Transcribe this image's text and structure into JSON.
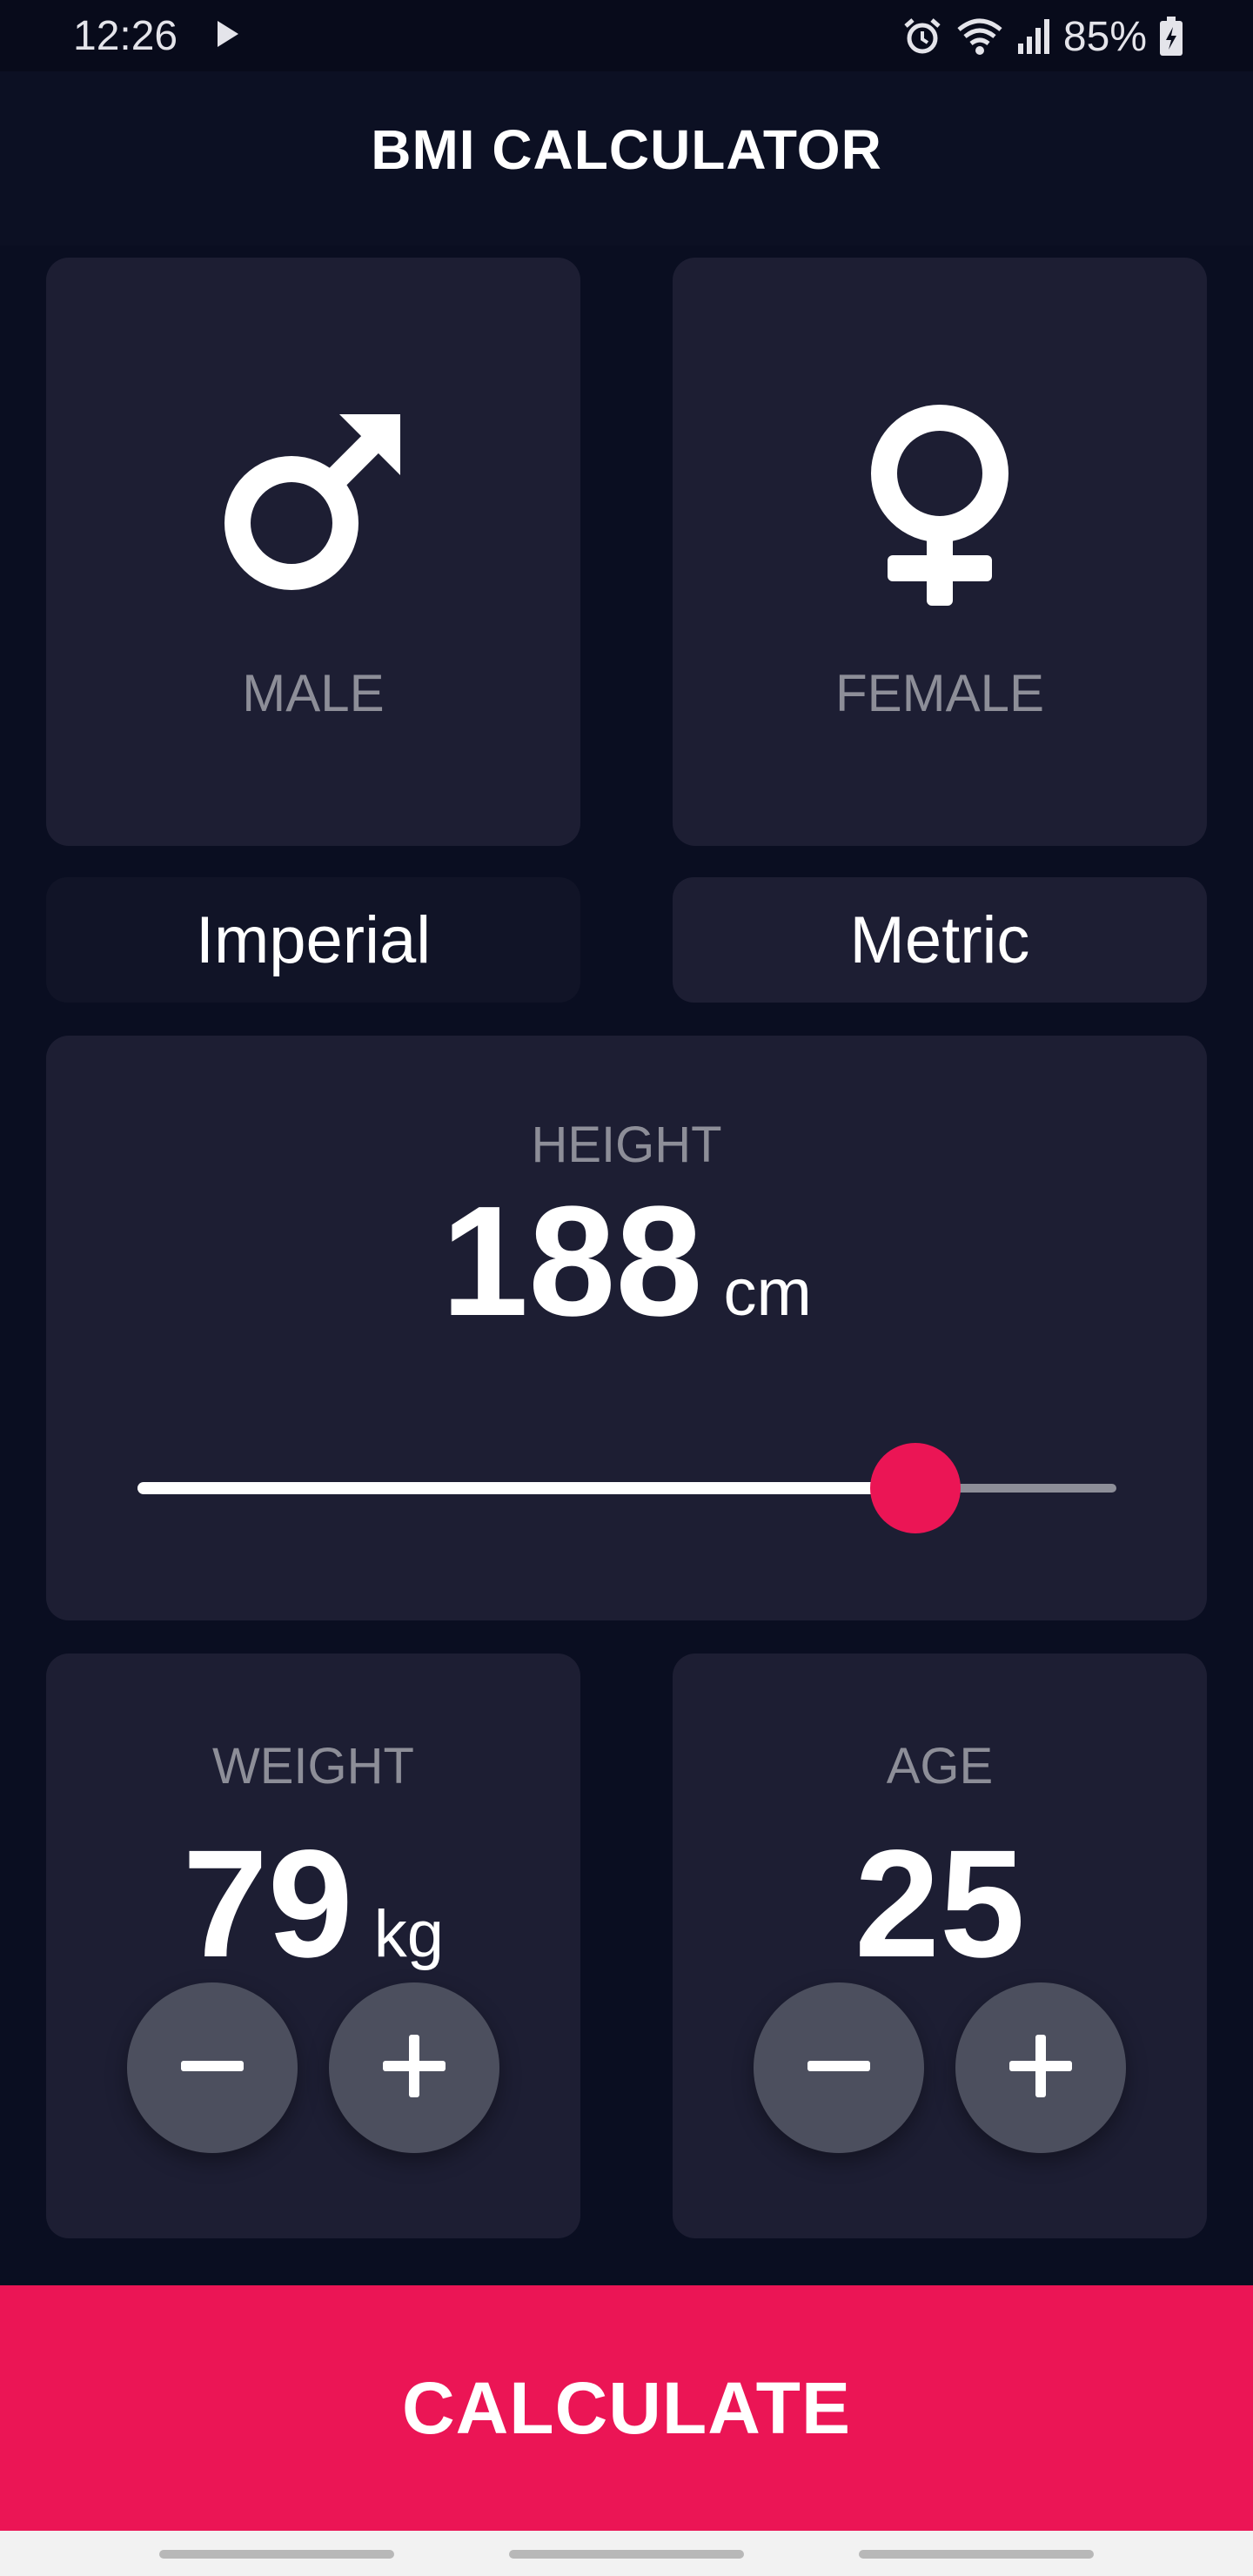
{
  "status_bar": {
    "time": "12:26",
    "battery": "85%",
    "icons": [
      "play-icon",
      "alarm-icon",
      "wifi-icon",
      "signal-icon",
      "battery-icon"
    ]
  },
  "app": {
    "title": "BMI CALCULATOR"
  },
  "gender": {
    "male_label": "MALE",
    "female_label": "FEMALE",
    "male_icon": "male-symbol-icon",
    "female_icon": "female-symbol-icon"
  },
  "units": {
    "imperial_label": "Imperial",
    "metric_label": "Metric"
  },
  "height": {
    "label": "HEIGHT",
    "value": "188",
    "unit": "cm",
    "slider_fraction": 0.795
  },
  "weight": {
    "label": "WEIGHT",
    "value": "79",
    "unit": "kg",
    "minus_icon": "minus-icon",
    "plus_icon": "plus-icon"
  },
  "age": {
    "label": "AGE",
    "value": "25",
    "minus_icon": "minus-icon",
    "plus_icon": "plus-icon"
  },
  "calculate_label": "CALCULATE",
  "colors": {
    "background": "#0a0e21",
    "card": "#1d1e33",
    "accent": "#eb1555",
    "label_gray": "#8d8e98",
    "round_button": "#4c4f5e"
  }
}
